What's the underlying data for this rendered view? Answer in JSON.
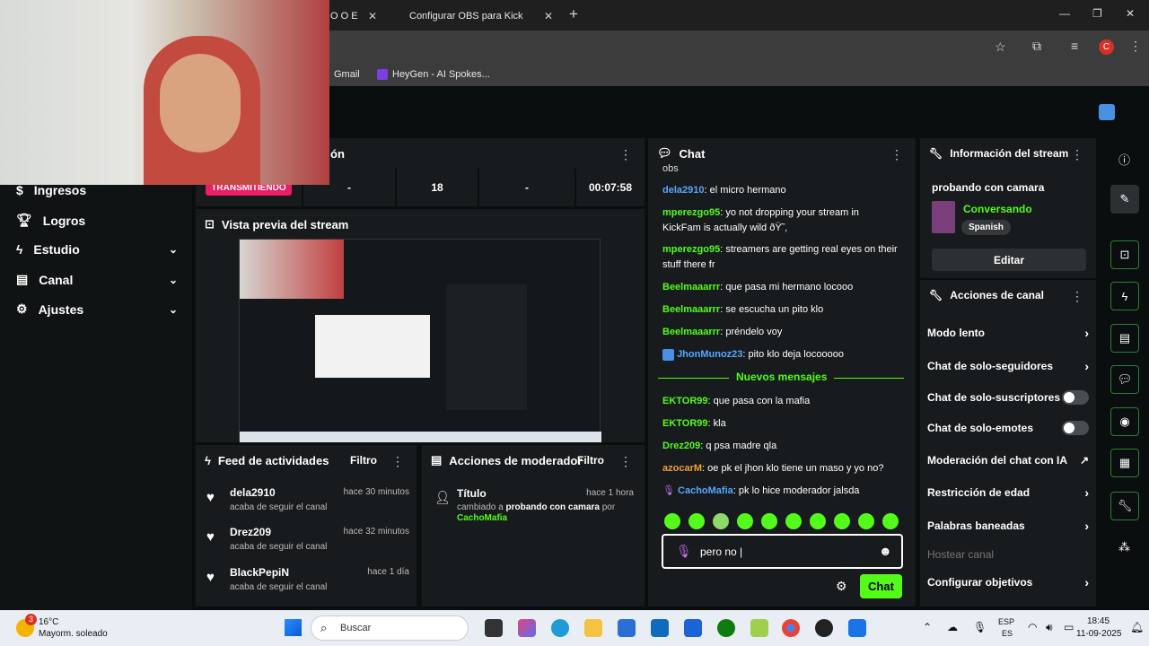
{
  "browser": {
    "tab1_label": "O O E",
    "tab2_label": "Configurar OBS para Kick",
    "new_tab": "+",
    "bookmarks": [
      "Gmail",
      "HeyGen - AI Spokes..."
    ],
    "profile_initial": "C"
  },
  "sidebar": {
    "items": [
      {
        "label": "Ingresos"
      },
      {
        "label": "Logros"
      },
      {
        "label": "Estudio"
      },
      {
        "label": "Canal"
      },
      {
        "label": "Ajustes"
      }
    ]
  },
  "session": {
    "title_suffix": "ón",
    "status_badge": "TRANSMITIENDO",
    "stats": [
      "-",
      "18",
      "-",
      "00:07:58"
    ]
  },
  "preview": {
    "title": "Vista previa del stream"
  },
  "activity": {
    "title": "Feed de actividades",
    "filter": "Filtro",
    "items": [
      {
        "user": "dela2910",
        "time": "hace 30 minutos",
        "desc": "acaba de seguir el canal"
      },
      {
        "user": "Drez209",
        "time": "hace 32 minutos",
        "desc": "acaba de seguir el canal"
      },
      {
        "user": "BlackPepiN",
        "time": "hace 1 día",
        "desc": "acaba de seguir el canal"
      }
    ]
  },
  "mod_actions": {
    "title": "Acciones de moderador",
    "filter": "Filtro",
    "entry": {
      "label": "Título",
      "time": "hace 1 hora",
      "line1_prefix": "cambiado a",
      "line1_value": "probando con camara",
      "line1_suffix": "por",
      "by_user": "CachoMafia"
    }
  },
  "chat": {
    "title": "Chat",
    "partial_top": "obs",
    "messages": [
      {
        "user": "dela2910",
        "text": "el micro hermano"
      },
      {
        "user": "mperezgo95",
        "text": "yo not dropping your stream in KickFam is actually wild ðŸ˜‚"
      },
      {
        "user": "mperezgo95",
        "text": "streamers are getting real eyes on their stuff there fr"
      },
      {
        "user": "Beelmaaarrr",
        "text": "que pasa mi hermano locooo"
      },
      {
        "user": "Beelmaaarrr",
        "text": "se escucha un pito klo"
      },
      {
        "user": "Beelmaaarrr",
        "text": "préndelo voy"
      },
      {
        "user": "JhonMunoz23",
        "text": "pito klo deja locooooo"
      }
    ],
    "new_messages_label": "Nuevos mensajes",
    "new_messages": [
      {
        "user": "EKTOR99",
        "text": "que pasa con la mafia"
      },
      {
        "user": "EKTOR99",
        "text": "kla"
      },
      {
        "user": "Drez209",
        "text": "q psa madre qla"
      },
      {
        "user": "azocarM",
        "text": "oe pk el jhon klo tiene un maso y yo no?"
      },
      {
        "user": "CachoMafia",
        "text": "pk lo hice moderador jalsda"
      }
    ],
    "input_value": "pero no |",
    "send_label": "Chat"
  },
  "stream_info": {
    "title": "Información del stream",
    "stream_title": "probando con camara",
    "category": "Conversando",
    "language": "Spanish",
    "edit_label": "Editar"
  },
  "channel_actions": {
    "title": "Acciones de canal",
    "items": [
      {
        "label": "Modo lento"
      },
      {
        "label": "Chat de solo-seguidores"
      },
      {
        "label": "Chat de solo-suscriptores"
      },
      {
        "label": "Chat de solo-emotes"
      },
      {
        "label": "Moderación del chat con IA"
      },
      {
        "label": "Restricción de edad"
      },
      {
        "label": "Palabras baneadas"
      },
      {
        "label": "Hostear canal"
      },
      {
        "label": "Configurar objetivos"
      }
    ]
  },
  "taskbar": {
    "weather_temp": "16°C",
    "weather_desc": "Mayorm. soleado",
    "weather_badge": "3",
    "search_placeholder": "Buscar",
    "lang_top": "ESP",
    "lang_bottom": "ES",
    "time": "18:45",
    "date": "11-09-2025"
  },
  "colors": {
    "kick_green": "#53fc18",
    "live_red": "#e91e63",
    "panel_bg": "#181b1d"
  }
}
